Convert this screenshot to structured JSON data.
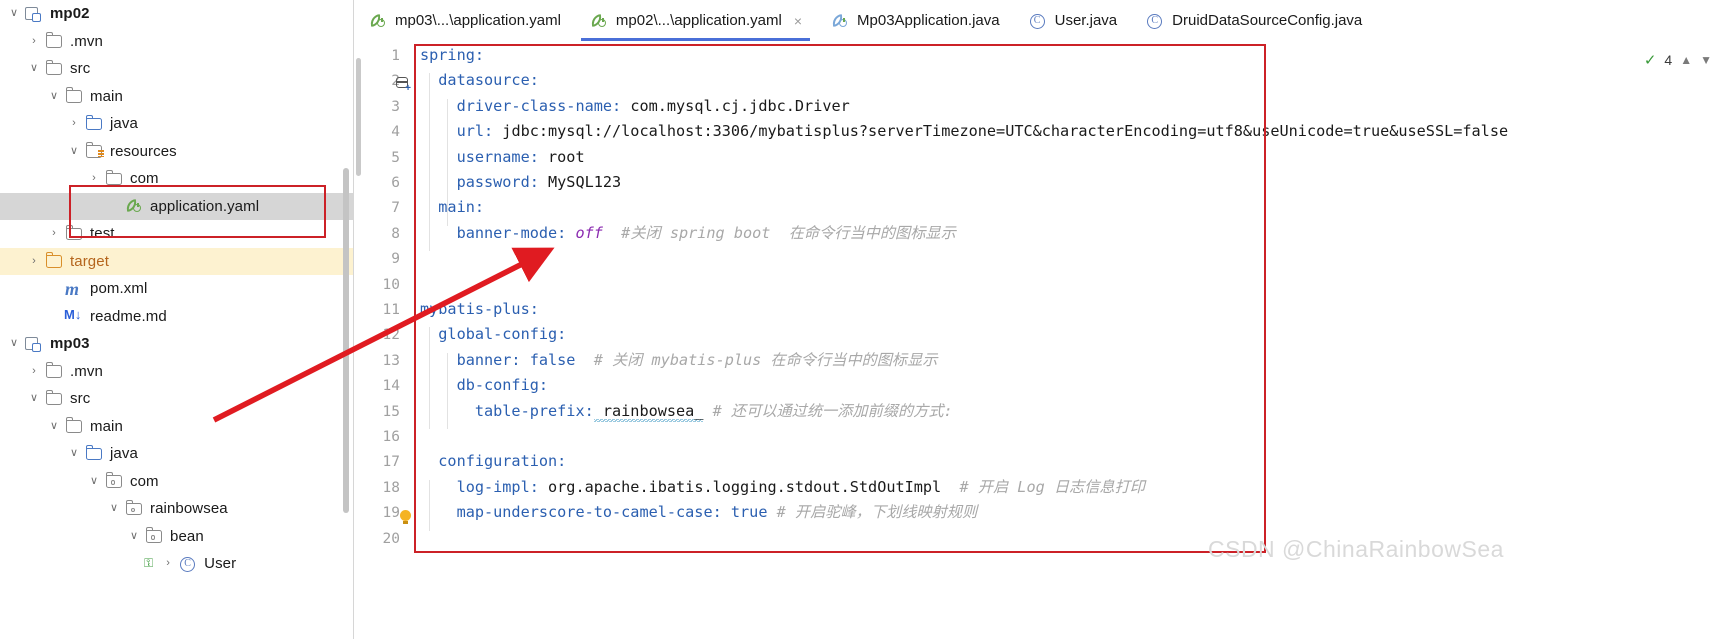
{
  "sidebar": {
    "scrollbar": "vertical-scrollbar",
    "items": [
      {
        "label": "mp02",
        "indent": 0,
        "chev": "down",
        "icon": "module-icon",
        "bold": true,
        "selected": false,
        "highlight": false
      },
      {
        "label": ".mvn",
        "indent": 1,
        "chev": "right",
        "icon": "folder-icon",
        "bold": false,
        "selected": false,
        "highlight": false
      },
      {
        "label": "src",
        "indent": 1,
        "chev": "down",
        "icon": "folder-icon",
        "bold": false,
        "selected": false,
        "highlight": false
      },
      {
        "label": "main",
        "indent": 2,
        "chev": "down",
        "icon": "folder-icon",
        "bold": false,
        "selected": false,
        "highlight": false
      },
      {
        "label": "java",
        "indent": 3,
        "chev": "right",
        "icon": "folder-blue-icon",
        "bold": false,
        "selected": false,
        "highlight": false
      },
      {
        "label": "resources",
        "indent": 3,
        "chev": "down",
        "icon": "folder-resources-icon",
        "bold": false,
        "selected": false,
        "highlight": false
      },
      {
        "label": "com",
        "indent": 4,
        "chev": "right",
        "icon": "folder-icon",
        "bold": false,
        "selected": false,
        "highlight": false
      },
      {
        "label": "application.yaml",
        "indent": 5,
        "chev": "none",
        "icon": "yaml-file-icon",
        "bold": false,
        "selected": true,
        "highlight": false
      },
      {
        "label": "test",
        "indent": 2,
        "chev": "right",
        "icon": "folder-icon",
        "bold": false,
        "selected": false,
        "highlight": false
      },
      {
        "label": "target",
        "indent": 1,
        "chev": "right",
        "icon": "folder-orange-icon",
        "bold": false,
        "selected": false,
        "highlight": true
      },
      {
        "label": "pom.xml",
        "indent": 2,
        "chev": "none",
        "icon": "maven-icon",
        "bold": false,
        "selected": false,
        "highlight": false
      },
      {
        "label": "readme.md",
        "indent": 2,
        "chev": "none",
        "icon": "markdown-icon",
        "bold": false,
        "selected": false,
        "highlight": false
      },
      {
        "label": "mp03",
        "indent": 0,
        "chev": "down",
        "icon": "module-icon",
        "bold": true,
        "selected": false,
        "highlight": false
      },
      {
        "label": ".mvn",
        "indent": 1,
        "chev": "right",
        "icon": "folder-icon",
        "bold": false,
        "selected": false,
        "highlight": false
      },
      {
        "label": "src",
        "indent": 1,
        "chev": "down",
        "icon": "folder-icon",
        "bold": false,
        "selected": false,
        "highlight": false
      },
      {
        "label": "main",
        "indent": 2,
        "chev": "down",
        "icon": "folder-icon",
        "bold": false,
        "selected": false,
        "highlight": false
      },
      {
        "label": "java",
        "indent": 3,
        "chev": "down",
        "icon": "folder-blue-icon",
        "bold": false,
        "selected": false,
        "highlight": false
      },
      {
        "label": "com",
        "indent": 4,
        "chev": "down",
        "icon": "package-icon",
        "bold": false,
        "selected": false,
        "highlight": false
      },
      {
        "label": "rainbowsea",
        "indent": 5,
        "chev": "down",
        "icon": "package-icon",
        "bold": false,
        "selected": false,
        "highlight": false
      },
      {
        "label": "bean",
        "indent": 6,
        "chev": "down",
        "icon": "package-icon",
        "bold": false,
        "selected": false,
        "highlight": false
      },
      {
        "label": "User",
        "indent": 7,
        "chev": "right",
        "icon": "java-class-icon",
        "bold": false,
        "selected": false,
        "highlight": false
      }
    ]
  },
  "tabs": [
    {
      "label": "mp03\\...\\application.yaml",
      "icon": "yaml-file-icon",
      "active": false,
      "closable": false
    },
    {
      "label": "mp02\\...\\application.yaml",
      "icon": "yaml-file-icon",
      "active": true,
      "closable": true,
      "close_label": "×"
    },
    {
      "label": "Mp03Application.java",
      "icon": "spring-boot-icon",
      "active": false,
      "closable": false
    },
    {
      "label": "User.java",
      "icon": "java-class-icon",
      "active": false,
      "closable": false
    },
    {
      "label": "DruidDataSourceConfig.java",
      "icon": "java-class-icon",
      "active": false,
      "closable": false
    }
  ],
  "inspections": {
    "status_icon": "check-ok-icon",
    "count": "4",
    "prev_icon": "chevron-up-icon",
    "next_icon": "chevron-down-icon"
  },
  "editor": {
    "gutter_numbers": [
      "1",
      "2",
      "3",
      "4",
      "5",
      "6",
      "7",
      "8",
      "9",
      "10",
      "11",
      "12",
      "13",
      "14",
      "15",
      "16",
      "17",
      "18",
      "19",
      "20"
    ],
    "line2_icon": "database-gutter-icon",
    "line19_icon": "intention-bulb-icon",
    "lines": [
      {
        "n": 1,
        "indent": 0,
        "key": "spring",
        "colon": ":",
        "value": "",
        "value_kind": "none",
        "comment": ""
      },
      {
        "n": 2,
        "indent": 1,
        "key": "datasource",
        "colon": ":",
        "value": "",
        "value_kind": "none",
        "comment": ""
      },
      {
        "n": 3,
        "indent": 2,
        "key": "driver-class-name",
        "colon": ":",
        "value": " com.mysql.cj.jdbc.Driver",
        "value_kind": "plain",
        "comment": ""
      },
      {
        "n": 4,
        "indent": 2,
        "key": "url",
        "colon": ":",
        "value": " jdbc:mysql://localhost:3306/mybatisplus?serverTimezone=UTC&characterEncoding=utf8&useUnicode=true&useSSL=false",
        "value_kind": "plain",
        "comment": ""
      },
      {
        "n": 5,
        "indent": 2,
        "key": "username",
        "colon": ":",
        "value": " root",
        "value_kind": "plain",
        "comment": ""
      },
      {
        "n": 6,
        "indent": 2,
        "key": "password",
        "colon": ":",
        "value": " MySQL123",
        "value_kind": "plain",
        "comment": ""
      },
      {
        "n": 7,
        "indent": 1,
        "key": "main",
        "colon": ":",
        "value": "",
        "value_kind": "none",
        "comment": ""
      },
      {
        "n": 8,
        "indent": 2,
        "key": "banner-mode",
        "colon": ":",
        "value": " off",
        "value_kind": "keyword",
        "comment": "  #关闭 spring boot  在命令行当中的图标显示"
      },
      {
        "n": 9,
        "indent": 0,
        "key": "",
        "colon": "",
        "value": "",
        "value_kind": "none",
        "comment": ""
      },
      {
        "n": 10,
        "indent": 0,
        "key": "",
        "colon": "",
        "value": "",
        "value_kind": "none",
        "comment": ""
      },
      {
        "n": 11,
        "indent": 0,
        "key": "mybatis-plus",
        "colon": ":",
        "value": "",
        "value_kind": "none",
        "comment": ""
      },
      {
        "n": 12,
        "indent": 1,
        "key": "global-config",
        "colon": ":",
        "value": "",
        "value_kind": "none",
        "comment": ""
      },
      {
        "n": 13,
        "indent": 2,
        "key": "banner",
        "colon": ":",
        "value": " false",
        "value_kind": "bool",
        "comment": "  # 关闭 mybatis-plus 在命令行当中的图标显示"
      },
      {
        "n": 14,
        "indent": 2,
        "key": "db-config",
        "colon": ":",
        "value": "",
        "value_kind": "none",
        "comment": ""
      },
      {
        "n": 15,
        "indent": 3,
        "key": "table-prefix",
        "colon": ":",
        "value": " rainbowsea_",
        "value_kind": "plain-typo",
        "comment": " # 还可以通过统一添加前缀的方式:"
      },
      {
        "n": 16,
        "indent": 0,
        "key": "",
        "colon": "",
        "value": "",
        "value_kind": "none",
        "comment": ""
      },
      {
        "n": 17,
        "indent": 1,
        "key": "configuration",
        "colon": ":",
        "value": "",
        "value_kind": "none",
        "comment": ""
      },
      {
        "n": 18,
        "indent": 2,
        "key": "log-impl",
        "colon": ":",
        "value": " org.apache.ibatis.logging.stdout.StdOutImpl",
        "value_kind": "plain",
        "comment": "  # 开启 Log 日志信息打印"
      },
      {
        "n": 19,
        "indent": 2,
        "key": "map-underscore-to-camel-case",
        "colon": ":",
        "value": " true",
        "value_kind": "bool",
        "comment": " # 开启驼峰，下划线映射规则"
      },
      {
        "n": 20,
        "indent": 0,
        "key": "",
        "colon": "",
        "value": "",
        "value_kind": "none",
        "comment": ""
      }
    ]
  },
  "annotations": {
    "watermark": "CSDN @ChinaRainbowSea",
    "highlight_color": "#cc2127",
    "file_box_name": "application-yaml-highlight-box",
    "editor_box_name": "editor-content-highlight-box",
    "arrow_name": "pointer-arrow"
  }
}
